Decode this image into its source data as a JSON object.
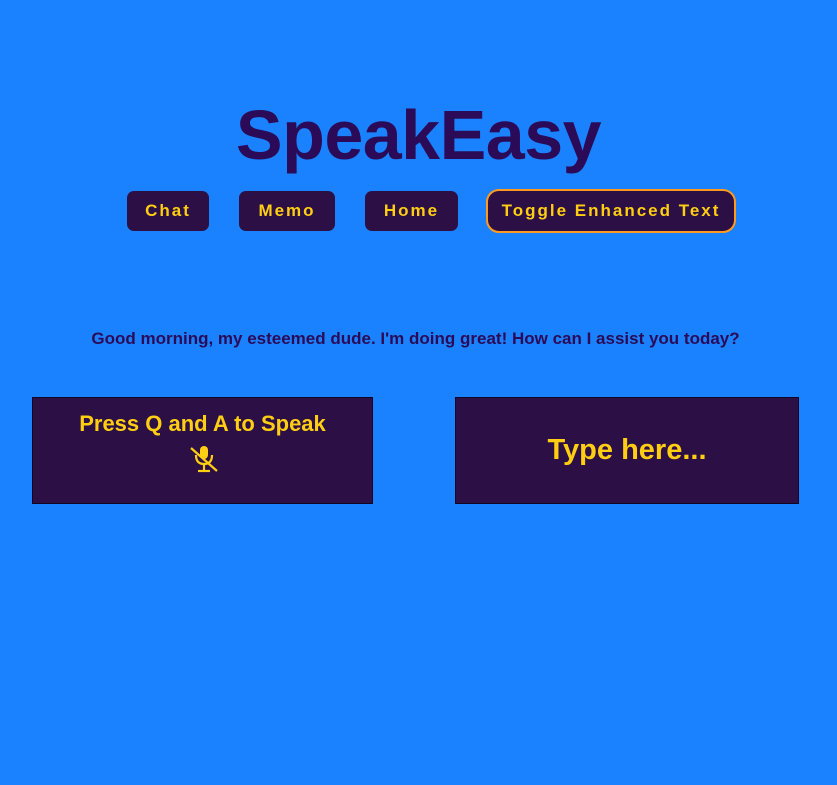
{
  "app": {
    "title": "SpeakEasy"
  },
  "nav": {
    "chat_label": "Chat",
    "memo_label": "Memo",
    "home_label": "Home",
    "toggle_label": "Toggle Enhanced Text"
  },
  "assistant": {
    "message": "Good morning, my esteemed dude. I'm doing great! How can I assist you today?"
  },
  "speak_panel": {
    "label": "Press Q and A to Speak",
    "icon": "microphone-muted-icon"
  },
  "type_panel": {
    "placeholder": "Type here...",
    "value": ""
  },
  "colors": {
    "background": "#1a82ff",
    "title": "#2b0b57",
    "panel": "#2b0f45",
    "accent_text": "#ffce12",
    "toggle_border": "#ff9a1f"
  }
}
